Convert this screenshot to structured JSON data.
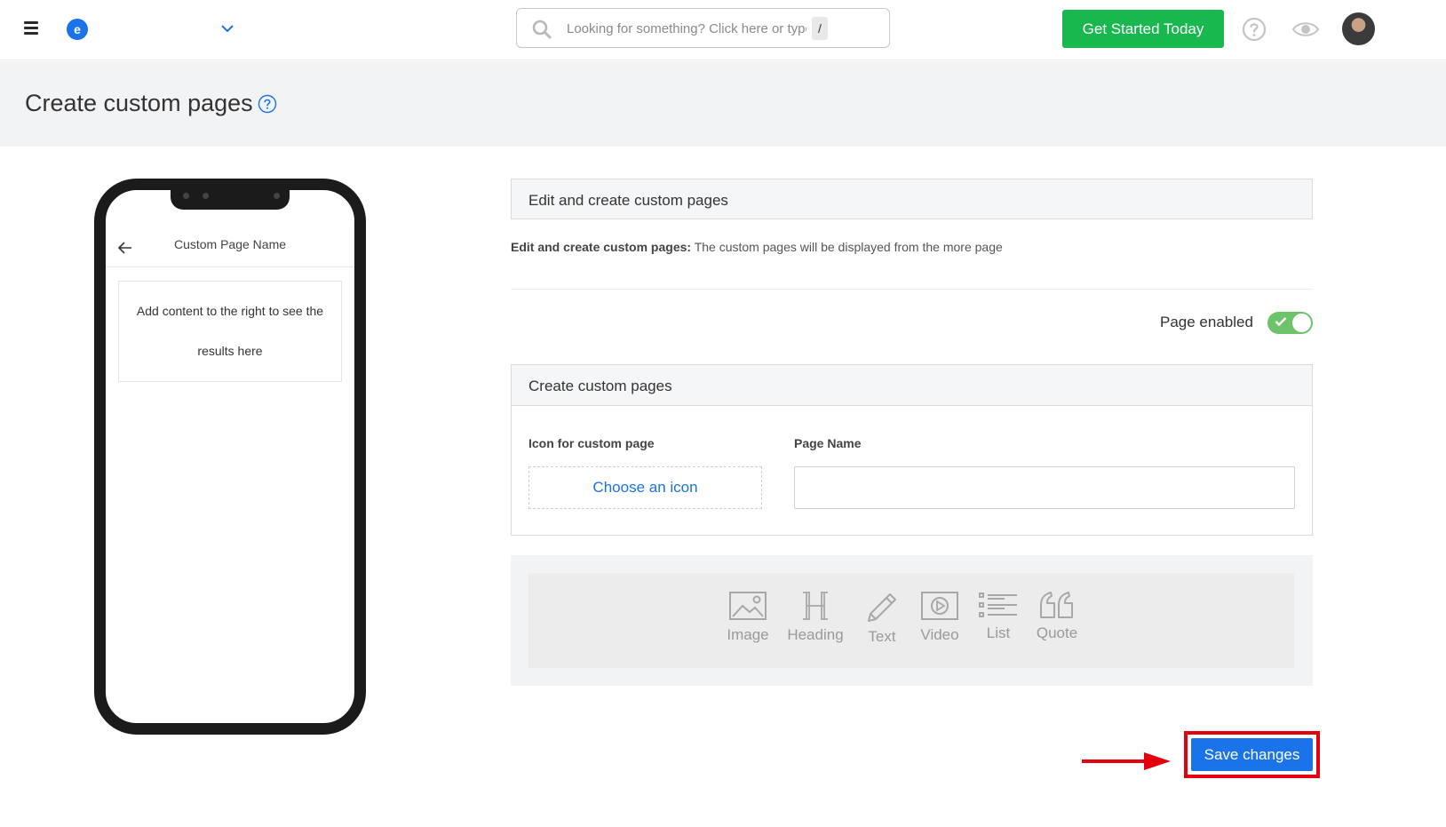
{
  "topbar": {
    "logo_letter": "e",
    "search_placeholder": "Looking for something? Click here or type",
    "search_shortcut": "/",
    "cta_label": "Get Started Today"
  },
  "page": {
    "title": "Create custom pages"
  },
  "preview": {
    "page_name": "Custom Page Name",
    "placeholder_line1": "Add content to the right to see the",
    "placeholder_line2": "results here"
  },
  "edit_panel": {
    "title": "Edit and create custom pages",
    "desc_bold": "Edit and create custom pages:",
    "desc_text": " The custom pages will be displayed from the more page"
  },
  "page_enabled": {
    "label": "Page enabled",
    "on": true
  },
  "create_panel": {
    "title": "Create custom pages",
    "icon_label": "Icon for custom page",
    "icon_button": "Choose an icon",
    "name_label": "Page Name",
    "name_value": ""
  },
  "blocks": [
    {
      "label": "Image"
    },
    {
      "label": "Heading"
    },
    {
      "label": "Text"
    },
    {
      "label": "Video"
    },
    {
      "label": "List"
    },
    {
      "label": "Quote"
    }
  ],
  "save_label": "Save changes",
  "colors": {
    "primary": "#1a73e8",
    "cta_green": "#19b84f",
    "toggle_on": "#6cc36a",
    "highlight": "#e3000f"
  }
}
